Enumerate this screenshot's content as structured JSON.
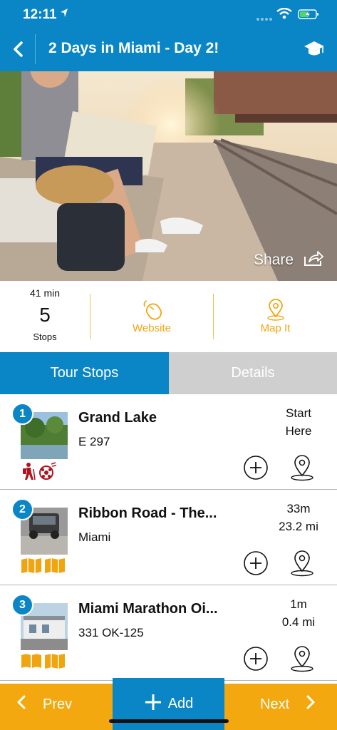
{
  "status": {
    "time": "12:11"
  },
  "header": {
    "title": "2 Days in Miami - Day 2!"
  },
  "hero": {
    "share_label": "Share"
  },
  "stats": {
    "duration": "41 min",
    "stop_count": "5",
    "stops_label": "Stops",
    "website_label": "Website",
    "mapit_label": "Map It"
  },
  "tabs": [
    {
      "label": "Tour Stops",
      "active": true
    },
    {
      "label": "Details",
      "active": false
    }
  ],
  "stops": [
    {
      "number": "1",
      "name": "Grand Lake",
      "address": "E 297",
      "dist_line1": "Start",
      "dist_line2": "Here",
      "categories": [
        "hiking-icon",
        "sports-icon"
      ]
    },
    {
      "number": "2",
      "name": "Ribbon Road - The...",
      "address": "Miami",
      "dist_line1": "33m",
      "dist_line2": "23.2 mi",
      "categories": [
        "map-icon",
        "map-icon"
      ]
    },
    {
      "number": "3",
      "name": "Miami Marathon Oi...",
      "address": "331 OK-125",
      "dist_line1": "1m",
      "dist_line2": "0.4 mi",
      "categories": [
        "book-icon",
        "map-icon"
      ]
    }
  ],
  "footer": {
    "prev_label": "Prev",
    "add_label": "Add",
    "next_label": "Next"
  },
  "colors": {
    "primary": "#0a86c6",
    "accent": "#f3a80f",
    "category_red": "#b0121e",
    "category_gold": "#f0a50e"
  }
}
